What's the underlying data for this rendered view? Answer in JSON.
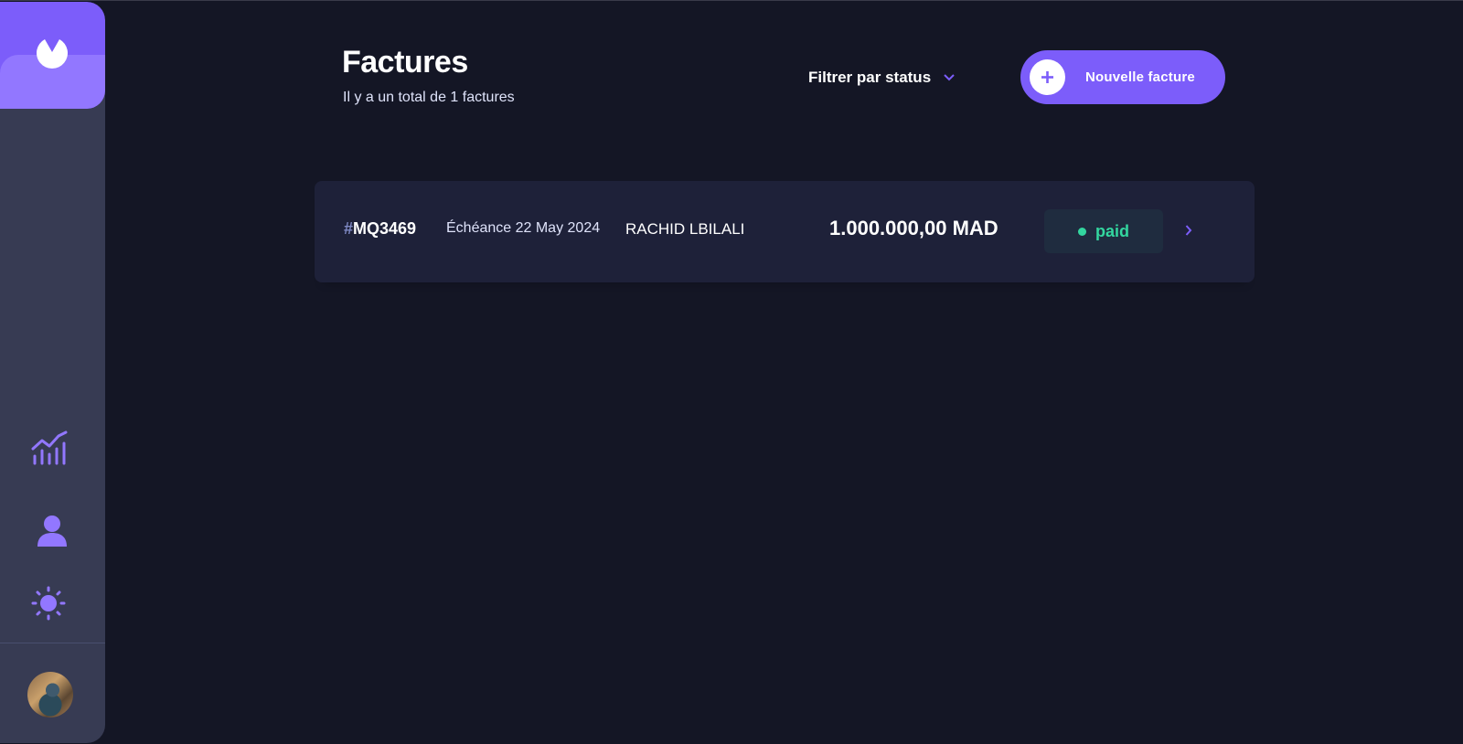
{
  "header": {
    "title": "Factures",
    "subtitle": "Il y a un total de 1 factures",
    "filter_label": "Filtrer par status",
    "new_invoice_label": "Nouvelle facture"
  },
  "sidebar": {
    "icons": [
      "logo-icon",
      "chart-icon",
      "user-icon",
      "sun-icon"
    ]
  },
  "invoices": [
    {
      "id_prefix": "#",
      "id": "MQ3469",
      "due": "Échéance 22 May 2024",
      "client": "RACHID LBILALI",
      "amount": "1.000.000,00 MAD",
      "status": "paid",
      "status_color": "#33d69f"
    }
  ],
  "colors": {
    "accent": "#7c5dfa",
    "accent_light": "#9277ff",
    "background": "#141625",
    "sidebar": "#373b53",
    "card": "#1e2139",
    "paid": "#33d69f"
  }
}
